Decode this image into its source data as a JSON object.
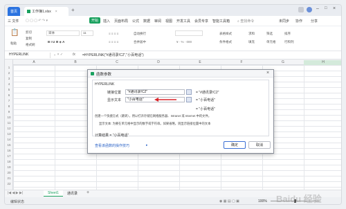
{
  "titlebar": {
    "home_tab": "首页",
    "file_tab": "工作簿1.xlsx",
    "new_tab": "+"
  },
  "menubar": {
    "items": [
      "三 文件",
      "开始",
      "插入",
      "页面布局",
      "公式",
      "数据",
      "审阅",
      "视图",
      "开发工具",
      "会员专享",
      "智能工具箱"
    ],
    "search": "查找命令",
    "right": [
      "未同步",
      "协作",
      "分享"
    ]
  },
  "ribbon": {
    "cut": "剪切",
    "copy": "复制",
    "paste": "粘贴",
    "brush": "格式刷",
    "font": "宋体",
    "size": "11",
    "wrap": "自动换行",
    "merge": "合并居中",
    "table_style": "表格样式",
    "cond": "条件格式",
    "sum": "求和",
    "filter": "筛选",
    "sort": "排序",
    "fill": "填充",
    "cell": "单元格",
    "rowcol": "行和列"
  },
  "formula_bar": {
    "name_box": "HYPERLINK",
    "fx": "fx",
    "formula": "=HYPERLINK(\"#通讯录!C2\",\"小百电话\")"
  },
  "columns": [
    "A",
    "B",
    "C",
    "D",
    "E",
    "F",
    "G",
    "H"
  ],
  "rows": [
    "1",
    "2",
    "3",
    "4",
    "5",
    "6",
    "7",
    "8",
    "9",
    "10",
    "11",
    "12",
    "13",
    "14",
    "15",
    "16",
    "17",
    "18",
    "19",
    "20",
    "21",
    "22"
  ],
  "sheets": {
    "sheet1": "Sheet1",
    "sheet2": "通讯录",
    "add": "+"
  },
  "status": {
    "left": "编辑状态",
    "zoom": "100%"
  },
  "dialog": {
    "title": "函数参数",
    "func_name": "HYPERLINK",
    "label1": "链接位置",
    "value1": "\"#通讯录!C2\"",
    "result1": "= \"#通讯录!C2\"",
    "label2": "显示文本",
    "value2": "\"小百电话\"",
    "result2": "= \"小百电话\"",
    "overall": "= \"小百电话\"",
    "desc1": "创建一个快捷方式（跳转），用以打开存储在网络服务器、Intranet 或 Internet 中的文件。",
    "desc2": "显示文本: 为要在单元格中显示的数字或字符串。如果省略，则显示链接位置中的文本",
    "calc_result": "计算结果 = \"小百电话\"",
    "help_link": "查看该函数的操作技巧",
    "ok": "确定",
    "cancel": "取消",
    "close": "×"
  },
  "colors": {
    "accent": "#1aa15f",
    "ok_border": "#3b6fd4",
    "arrow": "#d8242a",
    "active_header": "#d4eadb"
  },
  "watermark": "Baidu 经验"
}
